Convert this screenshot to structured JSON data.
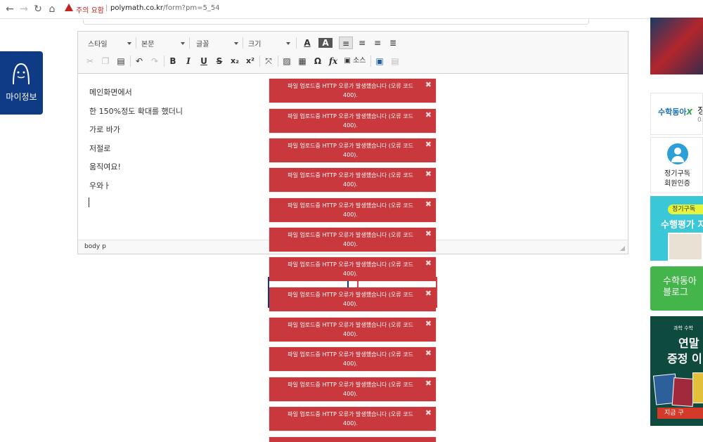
{
  "browser": {
    "back_icon": "back-arrow-icon",
    "forward_icon": "forward-arrow-icon",
    "reload_icon": "reload-icon",
    "home_icon": "home-icon",
    "warning_label": "주의 요함",
    "url_host": "polymath.co.kr",
    "url_path": "/form?pm=5_54"
  },
  "left_button": {
    "label": "마이정보"
  },
  "toolbar": {
    "style_label": "스타일",
    "format_label": "본문",
    "font_label": "글꼴",
    "size_label": "크기",
    "source_label": "소스"
  },
  "editor_content": {
    "lines": [
      "메인화면에서",
      "한 150%정도 확대를 했더니",
      "가로 바가",
      "저절로",
      "움직여요!",
      "우와ㅏ"
    ]
  },
  "statusbar": {
    "path": "body  p"
  },
  "toast": {
    "message": "파일 업로드중 HTTP 오류가 발생했습니다 (오류 코드 400).",
    "close_glyph": "✖",
    "color": "#c9383d"
  },
  "sidebar": {
    "math_logo": "수학동아",
    "math_logo_x": "X",
    "math_side_text": "정",
    "math_side_sub": "0:",
    "subscribe_label": "정기구독\n회원인증",
    "eval_pill": "정기구독",
    "eval_title": "수행평가 지",
    "blog_label": "수학동아\n블로그",
    "event_sub": "과학 수학",
    "event_title_1": "연말",
    "event_title_2": "증정 이",
    "event_cta": "지금 구"
  }
}
